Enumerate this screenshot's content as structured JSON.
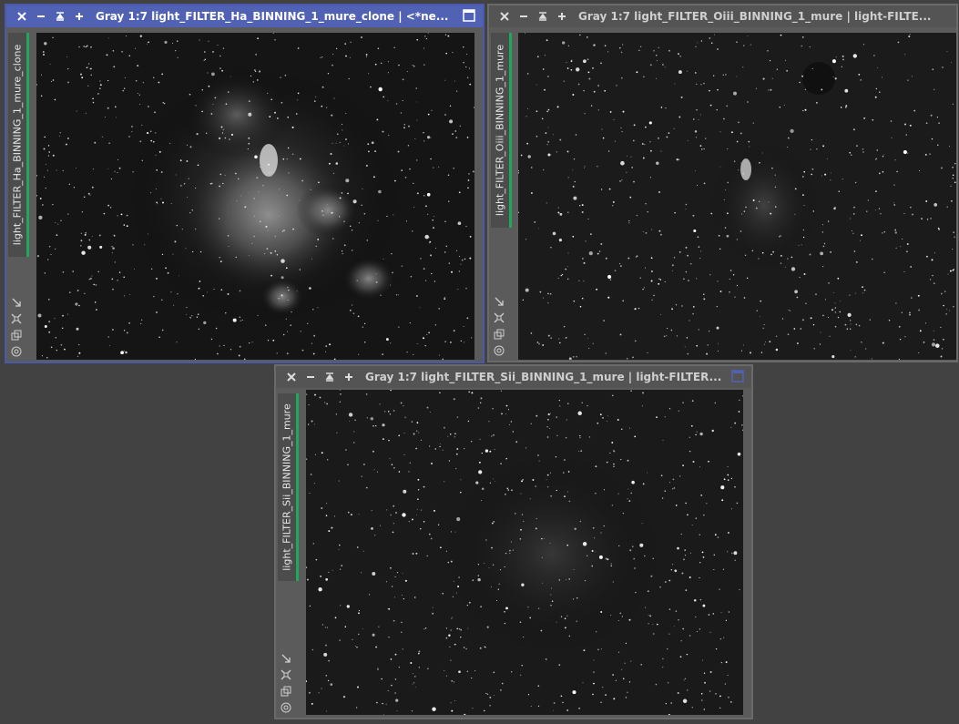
{
  "windows": [
    {
      "id": "ha",
      "title": "Gray 1:7 light_FILTER_Ha_BINNING_1_mure_clone | <*ne...",
      "tab_label": "light_FILTER_Ha_BINNING_1_mure_clone",
      "active": true
    },
    {
      "id": "oiii",
      "title": "Gray 1:7 light_FILTER_Oiii_BINNING_1_mure | light-FILTE...",
      "tab_label": "light_FILTER_Oiii_BINNING_1_mure",
      "active": false
    },
    {
      "id": "sii",
      "title": "Gray 1:7 light_FILTER_Sii_BINNING_1_mure | light-FILTER...",
      "tab_label": "light_FILTER_Sii_BINNING_1_mure",
      "active": false
    }
  ],
  "colors": {
    "workspace_bg": "#424242",
    "active_titlebar": "#5161b4",
    "inactive_titlebar": "#545454",
    "tab_accent": "#1fa85a"
  },
  "icons": [
    "close-icon",
    "minimize-icon",
    "shade-icon",
    "maximize-plus-icon",
    "restore-window-icon",
    "resize-arrow-icon",
    "fit-view-icon",
    "clone-view-icon",
    "target-icon"
  ]
}
